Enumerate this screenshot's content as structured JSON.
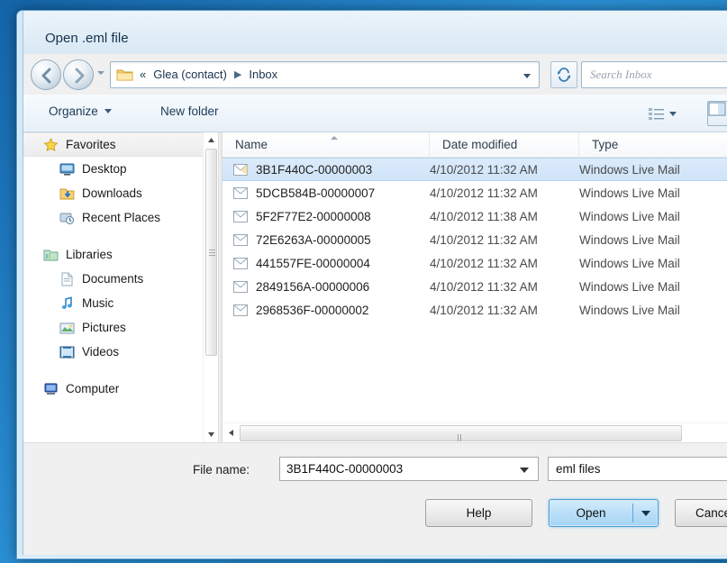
{
  "window": {
    "title": "Open .eml file"
  },
  "address_bar": {
    "folder_icon": "folder-icon",
    "overflow_chevrons": "«",
    "crumbs": [
      "Glea (contact)",
      "Inbox"
    ],
    "separator": "▶",
    "dropdown_icon": "chevron-down-icon",
    "refresh_icon": "refresh-icon"
  },
  "search": {
    "placeholder": "Search Inbox",
    "icon": "search-icon"
  },
  "nav": {
    "back_icon": "back-arrow-icon",
    "forward_icon": "forward-arrow-icon",
    "history_icon": "chevron-down-icon"
  },
  "toolbar": {
    "organize_label": "Organize",
    "organize_caret": "chevron-down-icon",
    "new_folder_label": "New folder",
    "view_icon": "list-view-icon",
    "view_caret": "chevron-down-icon",
    "preview_pane_icon": "preview-pane-icon"
  },
  "sidebar": {
    "groups": [
      {
        "header": {
          "label": "Favorites",
          "icon": "star-icon",
          "selected": true
        },
        "items": [
          {
            "label": "Desktop",
            "icon": "desktop-icon"
          },
          {
            "label": "Downloads",
            "icon": "downloads-icon"
          },
          {
            "label": "Recent Places",
            "icon": "recent-places-icon"
          }
        ]
      },
      {
        "header": {
          "label": "Libraries",
          "icon": "libraries-icon",
          "selected": false
        },
        "items": [
          {
            "label": "Documents",
            "icon": "documents-icon"
          },
          {
            "label": "Music",
            "icon": "music-icon"
          },
          {
            "label": "Pictures",
            "icon": "pictures-icon"
          },
          {
            "label": "Videos",
            "icon": "videos-icon"
          }
        ]
      },
      {
        "header": {
          "label": "Computer",
          "icon": "computer-icon",
          "selected": false
        },
        "items": []
      }
    ],
    "scrollbar": {
      "up_icon": "scroll-up-icon",
      "down_icon": "scroll-down-icon"
    }
  },
  "file_list": {
    "columns": [
      "Name",
      "Date modified",
      "Type"
    ],
    "sort_column": "Name",
    "sort_direction": "ascending",
    "rows": [
      {
        "name": "3B1F440C-00000003",
        "date": "4/10/2012 11:32 AM",
        "type": "Windows Live Mail",
        "icon": "email-icon",
        "selected": true
      },
      {
        "name": "5DCB584B-00000007",
        "date": "4/10/2012 11:32 AM",
        "type": "Windows Live Mail",
        "icon": "email-icon",
        "selected": false
      },
      {
        "name": "5F2F77E2-00000008",
        "date": "4/10/2012 11:38 AM",
        "type": "Windows Live Mail",
        "icon": "email-icon",
        "selected": false
      },
      {
        "name": "72E6263A-00000005",
        "date": "4/10/2012 11:32 AM",
        "type": "Windows Live Mail",
        "icon": "email-icon",
        "selected": false
      },
      {
        "name": "441557FE-00000004",
        "date": "4/10/2012 11:32 AM",
        "type": "Windows Live Mail",
        "icon": "email-icon",
        "selected": false
      },
      {
        "name": "2849156A-00000006",
        "date": "4/10/2012 11:32 AM",
        "type": "Windows Live Mail",
        "icon": "email-icon",
        "selected": false
      },
      {
        "name": "2968536F-00000002",
        "date": "4/10/2012 11:32 AM",
        "type": "Windows Live Mail",
        "icon": "email-icon",
        "selected": false
      }
    ],
    "hscrollbar": {
      "left_icon": "scroll-left-icon"
    }
  },
  "footer": {
    "file_name_label": "File name:",
    "file_name_value": "3B1F440C-00000003",
    "file_name_caret": "chevron-down-icon",
    "file_type_value": "eml files",
    "help_label": "Help",
    "open_label": "Open",
    "open_caret": "chevron-down-icon",
    "cancel_label": "Cancel"
  },
  "colors": {
    "accent": "#a5d4f5",
    "selection": "#cfe3f8",
    "frame": "#1a7fc8"
  }
}
